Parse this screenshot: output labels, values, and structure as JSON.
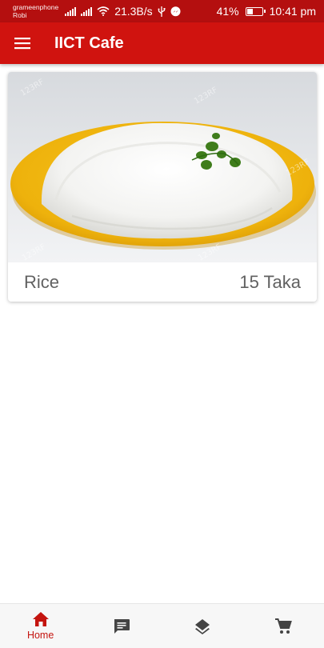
{
  "status_bar": {
    "carrier_1": "grameenphone",
    "carrier_2": "Robi",
    "network_speed": "21.3B/s",
    "battery": "41%",
    "battery_level": 0.41,
    "time": "10:41 pm"
  },
  "app_bar": {
    "title": "IICT Cafe",
    "menu_icon": "hamburger-menu-icon",
    "color": "#d0130f"
  },
  "items": [
    {
      "name": "Rice",
      "price": "15 Taka",
      "image": "plate of white rice with herb garnish"
    }
  ],
  "bottom_nav": {
    "active_color": "#c4140f",
    "inactive_color": "#444444",
    "items": [
      {
        "label": "Home",
        "icon": "home-icon",
        "active": true
      },
      {
        "label": "",
        "icon": "message-icon",
        "active": false
      },
      {
        "label": "",
        "icon": "layers-icon",
        "active": false
      },
      {
        "label": "",
        "icon": "cart-icon",
        "active": false
      }
    ]
  }
}
